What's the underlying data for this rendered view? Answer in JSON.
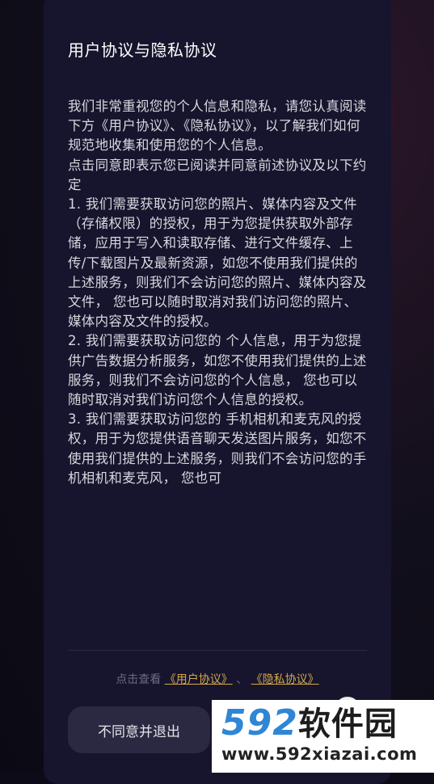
{
  "dialog": {
    "title": "用户协议与隐私协议",
    "paragraphs": [
      "我们非常重视您的个人信息和隐私，请您认真阅读下方《用户协议》、《隐私协议》，以了解我们如何规范地收集和使用您的个人信息。",
      "点击同意即表示您已阅读并同意前述协议及以下约定",
      "1. 我们需要获取访问您的照片、媒体内容及文件（存储权限）的授权，用于为您提供获取外部存储，应用于写入和读取存储、进行文件缓存、上传/下载图片及最新资源，如您不使用我们提供的上述服务，则我们不会访问您的照片、媒体内容及文件， 您也可以随时取消对我们访问您的照片、媒体内容及文件的授权。",
      "2. 我们需要获取访问您的 个人信息，用于为您提供广告数据分析服务，如您不使用我们提供的上述服务，则我们不会访问您的个人信息， 您也可以随时取消对我们访问您个人信息的授权。",
      "3. 我们需要获取访问您的 手机相机和麦克风的授权，用于为您提供语音聊天发送图片服务，如您不使用我们提供的上述服务，则我们不会访问您的手机相机和麦克风， 您也可"
    ],
    "links": {
      "prefix": "点击查看",
      "user_agreement": "《用户协议》",
      "separator": "、",
      "privacy_agreement": "《隐私协议》"
    },
    "buttons": {
      "disagree": "不同意并退出"
    }
  },
  "watermark": {
    "logo_number": "592",
    "logo_text": "软件园",
    "url": "www.592xiazai.com"
  },
  "colors": {
    "dialog_bg": "#17152d",
    "link": "#d4a84a",
    "button_bg": "#2b2942",
    "watermark_blue": "#2f86d6"
  }
}
